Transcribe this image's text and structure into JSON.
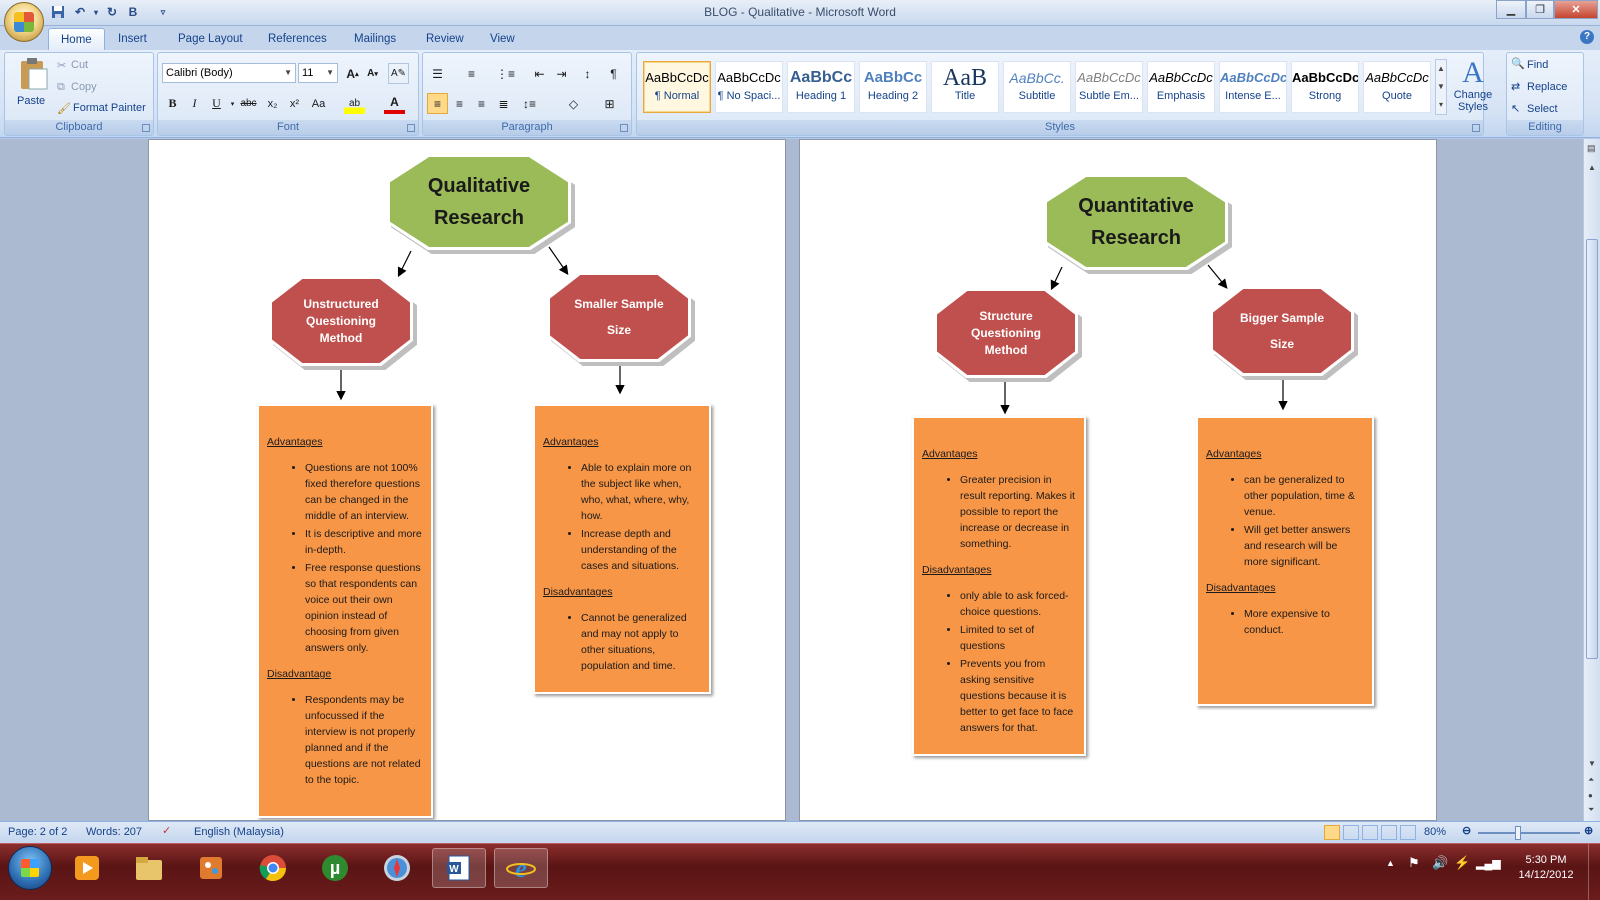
{
  "window": {
    "title": "BLOG - Qualitative - Microsoft Word",
    "quick_access": {
      "bold_label": "B"
    }
  },
  "tabs": [
    "Home",
    "Insert",
    "Page Layout",
    "References",
    "Mailings",
    "Review",
    "View"
  ],
  "active_tab": "Home",
  "ribbon": {
    "clipboard": {
      "label": "Clipboard",
      "paste": "Paste",
      "cut": "Cut",
      "copy": "Copy",
      "format_painter": "Format Painter"
    },
    "font": {
      "label": "Font",
      "font_name": "Calibri (Body)",
      "font_size": "11"
    },
    "paragraph": {
      "label": "Paragraph"
    },
    "styles": {
      "label": "Styles",
      "items": [
        {
          "sample": "AaBbCcDc",
          "name": "¶ Normal"
        },
        {
          "sample": "AaBbCcDc",
          "name": "¶ No Spaci..."
        },
        {
          "sample": "AaBbCc",
          "name": "Heading 1"
        },
        {
          "sample": "AaBbCc",
          "name": "Heading 2"
        },
        {
          "sample": "AaB",
          "name": "Title"
        },
        {
          "sample": "AaBbCc.",
          "name": "Subtitle"
        },
        {
          "sample": "AaBbCcDc",
          "name": "Subtle Em..."
        },
        {
          "sample": "AaBbCcDc",
          "name": "Emphasis"
        },
        {
          "sample": "AaBbCcDc",
          "name": "Intense E..."
        },
        {
          "sample": "AaBbCcDc",
          "name": "Strong"
        },
        {
          "sample": "AaBbCcDc",
          "name": "Quote"
        }
      ],
      "change_styles": "Change Styles"
    },
    "editing": {
      "label": "Editing",
      "find": "Find",
      "replace": "Replace",
      "select": "Select"
    }
  },
  "document": {
    "left": {
      "title_line1": "Qualitative",
      "title_line2": "Research",
      "node_a": [
        "Unstructured",
        "Questioning",
        "Method"
      ],
      "node_b": [
        "Smaller Sample",
        "Size"
      ],
      "box_a": {
        "adv_heading": "Advantages",
        "adv": [
          "Questions are not 100% fixed therefore questions can be changed in the middle of an interview.",
          "It is descriptive and more in-depth.",
          "Free response questions so that respondents can voice out their own opinion instead of choosing from given answers only."
        ],
        "dis_heading": "Disadvantage",
        "dis": [
          "Respondents may be unfocussed if the interview is not properly planned and if the questions are not related to the topic."
        ]
      },
      "box_b": {
        "adv_heading": "Advantages",
        "adv": [
          "Able to explain more on the subject like when, who, what, where, why, how.",
          "Increase depth and understanding of the cases and situations."
        ],
        "dis_heading": "Disadvantages",
        "dis": [
          "Cannot be generalized and may not apply to other situations, population and time."
        ]
      }
    },
    "right": {
      "title_line1": "Quantitative",
      "title_line2": "Research",
      "node_a": [
        "Structure",
        "Questioning",
        "Method"
      ],
      "node_b": [
        "Bigger Sample",
        "Size"
      ],
      "box_a": {
        "adv_heading": "Advantages",
        "adv": [
          "Greater precision in result reporting. Makes it possible to report the increase or decrease in something."
        ],
        "dis_heading": "Disadvantages",
        "dis": [
          "only able to ask forced-choice questions.",
          "Limited to set of questions",
          "Prevents you from asking sensitive questions because it is better to get face to face answers for that."
        ]
      },
      "box_b": {
        "adv_heading": "Advantages",
        "adv": [
          "can be generalized to other population, time & venue.",
          "Will get better answers and research will be more significant."
        ],
        "dis_heading": "Disadvantages",
        "dis": [
          "More expensive to conduct."
        ]
      }
    }
  },
  "status": {
    "page": "Page: 2 of 2",
    "words": "Words: 207",
    "language": "English (Malaysia)",
    "zoom": "80%",
    "zoom_percent": 80
  },
  "taskbar": {
    "time": "5:30 PM",
    "date": "14/12/2012",
    "apps": [
      "start-orb",
      "media-player",
      "file-explorer",
      "paint",
      "chrome",
      "utorrent",
      "safari",
      "word",
      "internet-explorer"
    ]
  },
  "colors": {
    "ribbon_blue": "#d6e3f5",
    "green_node": "#9bbb59",
    "red_node": "#c0504d",
    "orange_box": "#f79646",
    "taskbar": "#6b1c1c"
  }
}
